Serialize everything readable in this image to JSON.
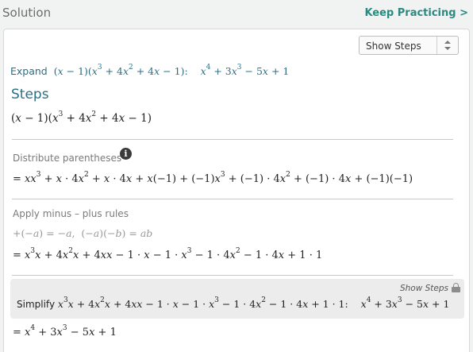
{
  "header": {
    "title": "Solution",
    "keep_practicing": "Keep Practicing >"
  },
  "controls": {
    "show_steps_select": "Show Steps",
    "show_steps_link": "Show Steps"
  },
  "expand": {
    "label": "Expand"
  },
  "steps": {
    "heading": "Steps"
  },
  "step_labels": {
    "distribute": "Distribute parentheses",
    "minus_plus": "Apply minus – plus rules",
    "simplify": "Simplify"
  },
  "icons": {
    "info": "info-icon",
    "lock": "lock-icon",
    "select_arrows": "updown-arrows-icon"
  },
  "colors": {
    "accent": "#2b8a80",
    "heading": "#2a6f86",
    "panel": "#ececec"
  }
}
